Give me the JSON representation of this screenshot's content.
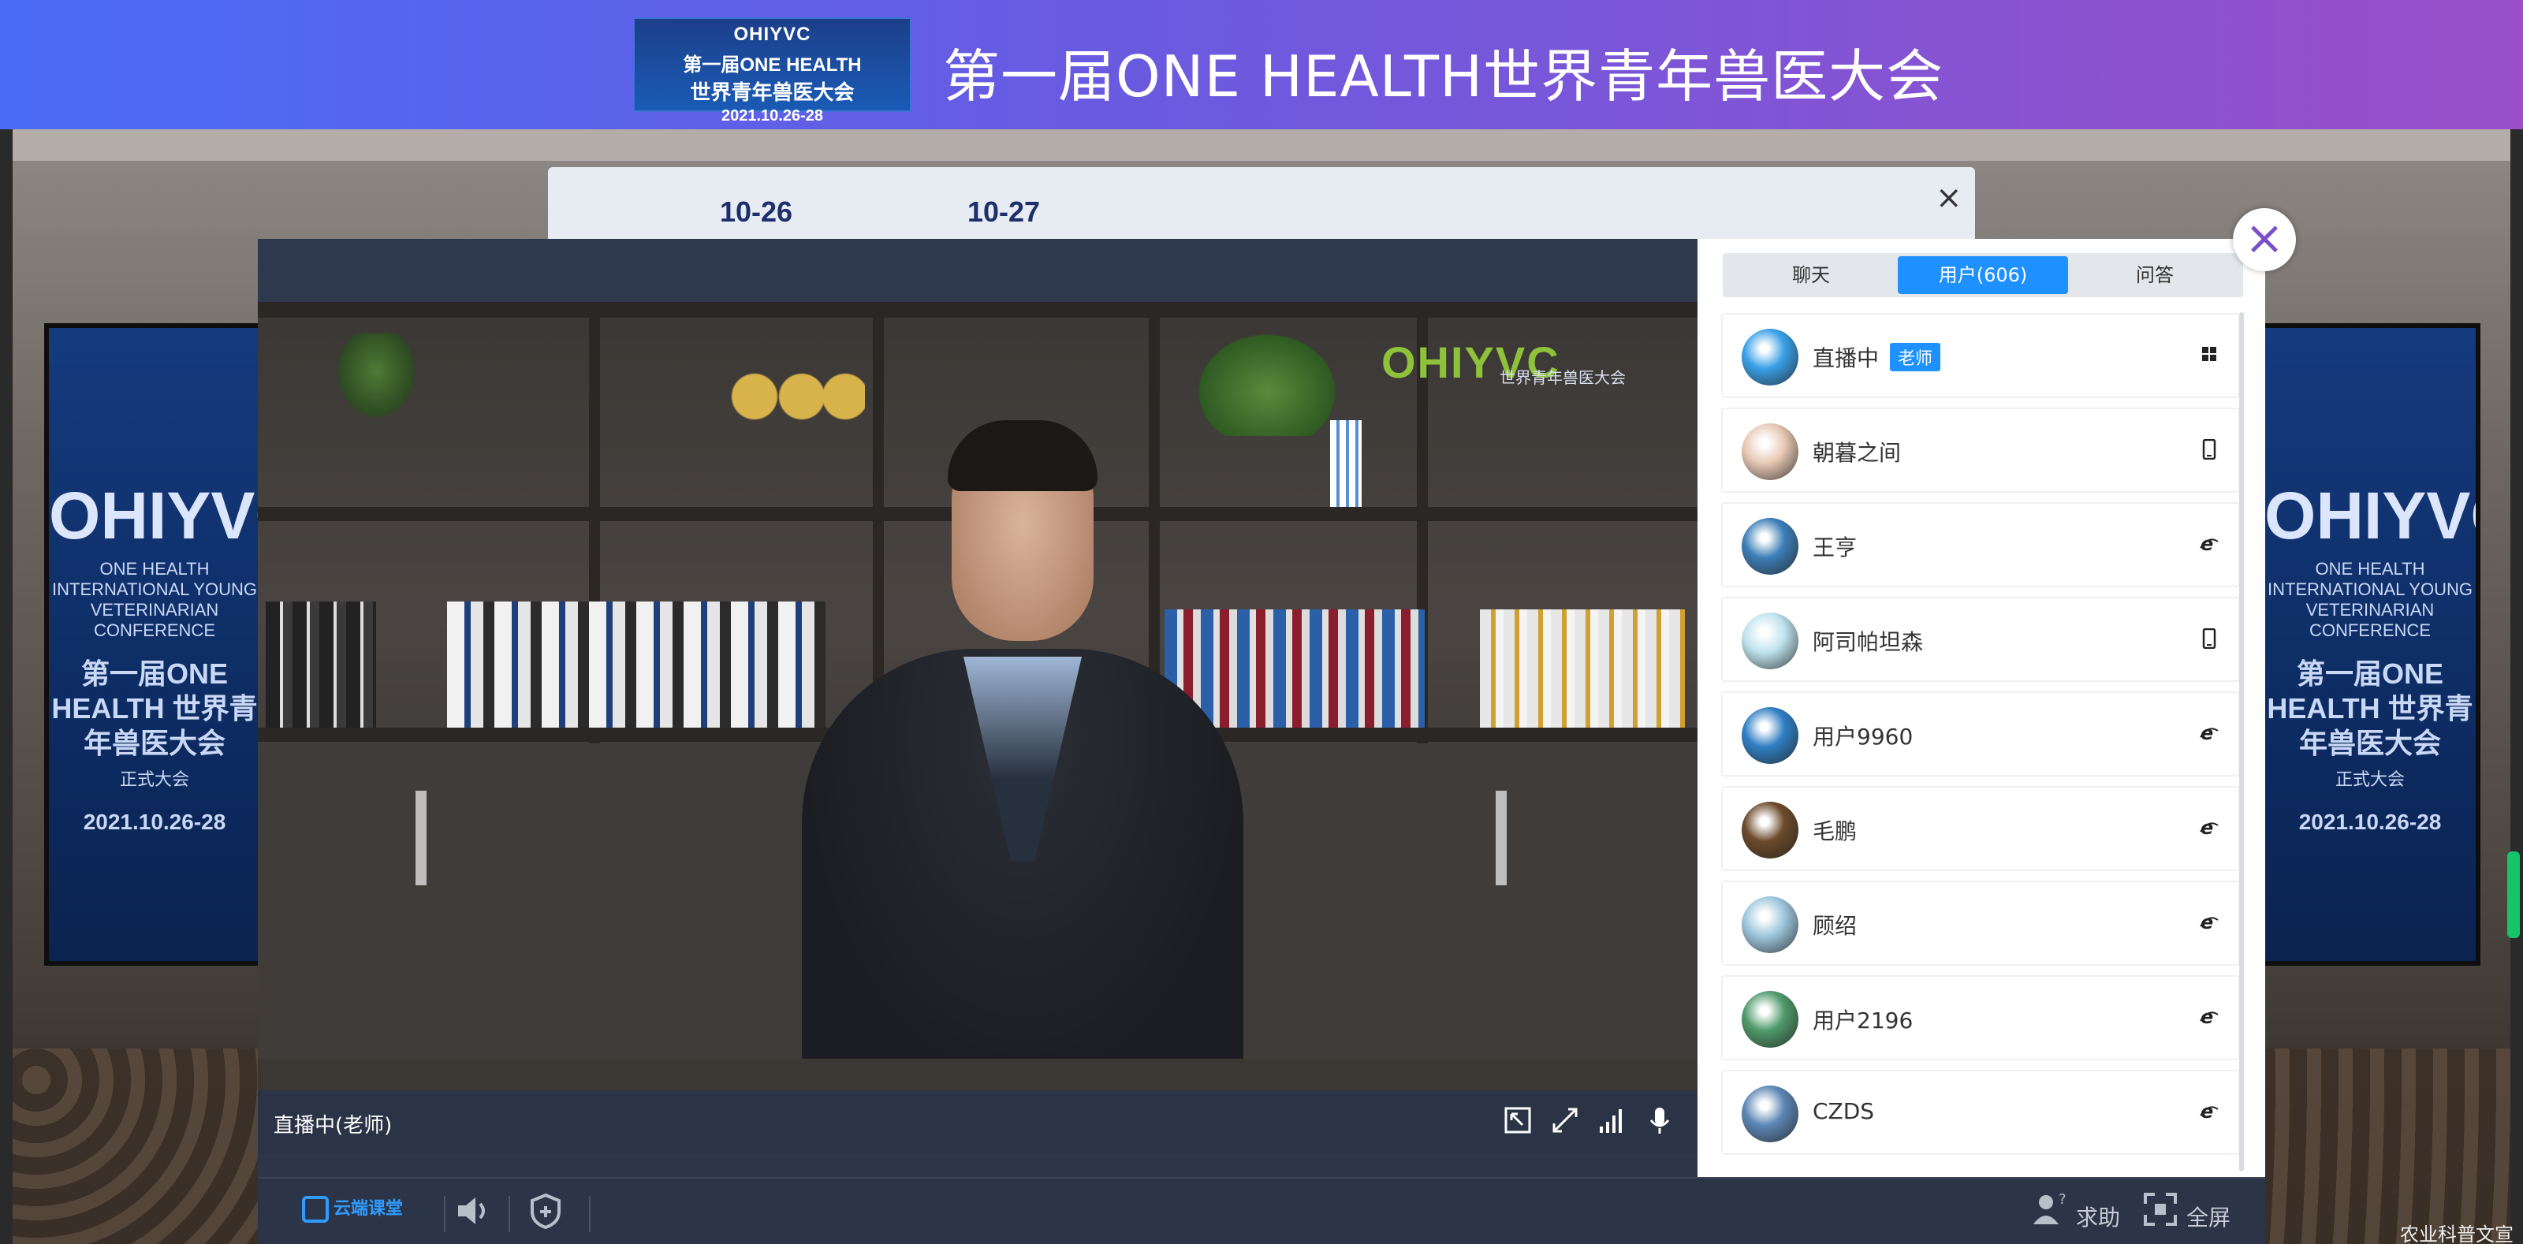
{
  "header": {
    "title": "第一届ONE HEALTH世界青年兽医大会",
    "logo_lines": [
      "OHIYVC",
      "第一届ONE HEALTH",
      "世界青年兽医大会",
      "2021.10.26-28"
    ]
  },
  "schedule": {
    "tabs": [
      "10-26",
      "10-27"
    ],
    "close": "×"
  },
  "background_screens": {
    "logo": "OHIYVC",
    "sub": "ONE HEALTH INTERNATIONAL YOUNG VETERINARIAN CONFERENCE",
    "cn": "第一届ONE HEALTH 世界青年兽医大会",
    "tag": "正式大会",
    "date": "2021.10.26-28"
  },
  "video": {
    "watermark_logo": "OHIYVC",
    "watermark_cn": "世界青年兽医大会",
    "host_label": "直播中(老师)"
  },
  "side_panel": {
    "tabs": [
      {
        "label": "聊天",
        "active": false
      },
      {
        "label": "用户(606)",
        "active": true
      },
      {
        "label": "问答",
        "active": false
      }
    ],
    "users": [
      {
        "name": "直播中",
        "badge": "老师",
        "device": "windows-icon",
        "color": "#3aa0e8"
      },
      {
        "name": "朝暮之间",
        "badge": "",
        "device": "mobile-icon",
        "color": "#e8c9b5"
      },
      {
        "name": "王亨",
        "badge": "",
        "device": "ie-icon",
        "color": "#3c7fb8"
      },
      {
        "name": "阿司帕坦森",
        "badge": "",
        "device": "mobile-icon",
        "color": "#bfe3ee"
      },
      {
        "name": "用户9960",
        "badge": "",
        "device": "ie-icon",
        "color": "#2f7fc4"
      },
      {
        "name": "毛鹏",
        "badge": "",
        "device": "ie-icon",
        "color": "#6b4a2a"
      },
      {
        "name": "顾绍",
        "badge": "",
        "device": "ie-icon",
        "color": "#9ec7dd"
      },
      {
        "name": "用户2196",
        "badge": "",
        "device": "ie-icon",
        "color": "#4f9a6a"
      },
      {
        "name": "CZDS",
        "badge": "",
        "device": "ie-icon",
        "color": "#5c86b4"
      }
    ]
  },
  "bottom_bar": {
    "brand": "云端课堂",
    "help": "求助",
    "fullscreen": "全屏"
  },
  "close_label": "×",
  "corner_text": "农业科普文宣"
}
